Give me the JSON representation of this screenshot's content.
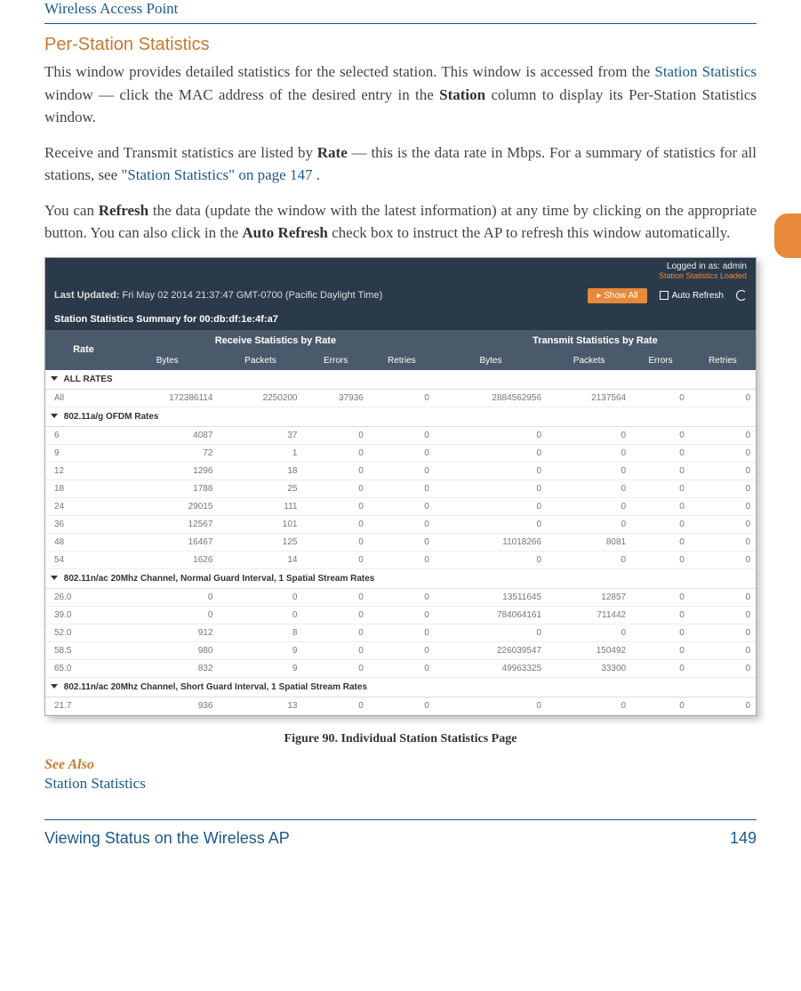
{
  "header": {
    "title": "Wireless Access Point"
  },
  "section": {
    "title": "Per-Station Statistics"
  },
  "para1": {
    "t1": "This window provides detailed statistics for the selected station. This window is accessed from the ",
    "link1": "Station Statistics",
    "t2": " window — click the MAC address of the desired entry in the ",
    "b1": "Station",
    "t3": " column to display its Per-Station Statistics window."
  },
  "para2": {
    "t1": "Receive and Transmit statistics are listed by ",
    "b1": "Rate",
    "t2": " — this is the data rate in Mbps. For a summary of statistics for all stations, see ",
    "link1": "\"Station Statistics\" on page 147",
    "t3": "."
  },
  "para3": {
    "t1": "You can ",
    "b1": "Refresh",
    "t2": " the data (update the window with the latest information) at any time by clicking on the appropriate button. You can also click in the ",
    "b2": "Auto Refresh",
    "t3": " check box to instruct the AP to refresh this window automatically."
  },
  "screenshot": {
    "logged_in": "Logged in as: admin",
    "loaded": "Station Statistics Loaded",
    "last_updated_label": "Last Updated:",
    "last_updated_value": "Fri May 02 2014 21:37:47 GMT-0700 (Pacific Daylight Time)",
    "show_all": "Show All",
    "auto_refresh": "Auto Refresh",
    "summary_title": "Station Statistics Summary for 00:db:df:1e:4f:a7",
    "head": {
      "rate": "Rate",
      "rx": "Receive Statistics by Rate",
      "tx": "Transmit Statistics by Rate",
      "cols": [
        "Bytes",
        "Packets",
        "Errors",
        "Retries",
        "Bytes",
        "Packets",
        "Errors",
        "Retries"
      ]
    },
    "sections": [
      {
        "label": "ALL RATES",
        "rows": [
          {
            "rate": "All",
            "v": [
              "172386114",
              "2250200",
              "37936",
              "0",
              "2884562956",
              "2137564",
              "0",
              "0"
            ]
          }
        ]
      },
      {
        "label": "802.11a/g OFDM Rates",
        "rows": [
          {
            "rate": "6",
            "v": [
              "4087",
              "37",
              "0",
              "0",
              "0",
              "0",
              "0",
              "0"
            ]
          },
          {
            "rate": "9",
            "v": [
              "72",
              "1",
              "0",
              "0",
              "0",
              "0",
              "0",
              "0"
            ]
          },
          {
            "rate": "12",
            "v": [
              "1296",
              "18",
              "0",
              "0",
              "0",
              "0",
              "0",
              "0"
            ]
          },
          {
            "rate": "18",
            "v": [
              "1788",
              "25",
              "0",
              "0",
              "0",
              "0",
              "0",
              "0"
            ]
          },
          {
            "rate": "24",
            "v": [
              "29015",
              "111",
              "0",
              "0",
              "0",
              "0",
              "0",
              "0"
            ]
          },
          {
            "rate": "36",
            "v": [
              "12567",
              "101",
              "0",
              "0",
              "0",
              "0",
              "0",
              "0"
            ]
          },
          {
            "rate": "48",
            "v": [
              "16467",
              "125",
              "0",
              "0",
              "11018266",
              "8081",
              "0",
              "0"
            ]
          },
          {
            "rate": "54",
            "v": [
              "1626",
              "14",
              "0",
              "0",
              "0",
              "0",
              "0",
              "0"
            ]
          }
        ]
      },
      {
        "label": "802.11n/ac 20Mhz Channel, Normal Guard Interval, 1 Spatial Stream Rates",
        "rows": [
          {
            "rate": "26.0",
            "v": [
              "0",
              "0",
              "0",
              "0",
              "13511645",
              "12857",
              "0",
              "0"
            ]
          },
          {
            "rate": "39.0",
            "v": [
              "0",
              "0",
              "0",
              "0",
              "784064161",
              "711442",
              "0",
              "0"
            ]
          },
          {
            "rate": "52.0",
            "v": [
              "912",
              "8",
              "0",
              "0",
              "0",
              "0",
              "0",
              "0"
            ]
          },
          {
            "rate": "58.5",
            "v": [
              "980",
              "9",
              "0",
              "0",
              "226039547",
              "150492",
              "0",
              "0"
            ]
          },
          {
            "rate": "65.0",
            "v": [
              "832",
              "9",
              "0",
              "0",
              "49963325",
              "33300",
              "0",
              "0"
            ]
          }
        ]
      },
      {
        "label": "802.11n/ac 20Mhz Channel, Short Guard Interval, 1 Spatial Stream Rates",
        "rows": [
          {
            "rate": "21.7",
            "v": [
              "936",
              "13",
              "0",
              "0",
              "0",
              "0",
              "0",
              "0"
            ]
          }
        ]
      }
    ]
  },
  "figure_caption": "Figure 90. Individual Station Statistics Page",
  "see_also": {
    "heading": "See Also",
    "link": "Station Statistics"
  },
  "footer": {
    "left": "Viewing Status on the Wireless AP",
    "right": "149"
  }
}
